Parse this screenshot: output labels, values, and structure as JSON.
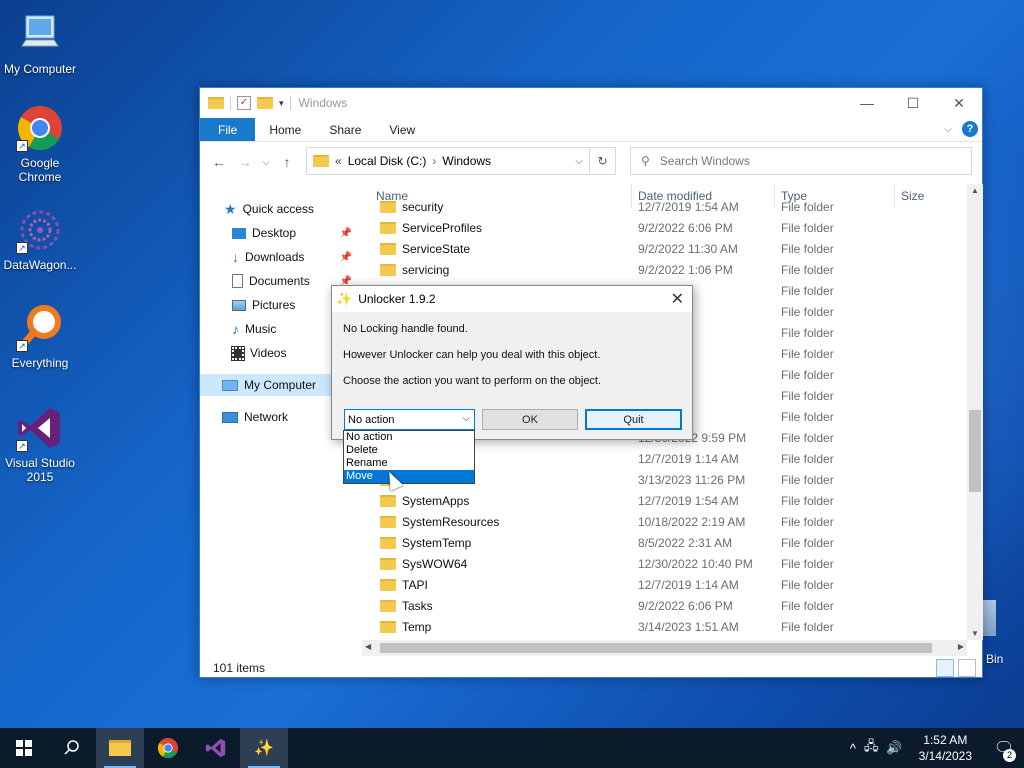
{
  "desktop": {
    "icons": [
      {
        "label": "My Computer"
      },
      {
        "label": "Google Chrome"
      },
      {
        "label": "DataWagon..."
      },
      {
        "label": "Everything"
      },
      {
        "label": "Visual Studio 2015"
      }
    ],
    "recycle_label": "Bin"
  },
  "explorer": {
    "title": "Windows",
    "tabs": {
      "file": "File",
      "home": "Home",
      "share": "Share",
      "view": "View"
    },
    "address": {
      "root": "Local Disk (C:)",
      "current": "Windows",
      "chevrons": "«"
    },
    "search_placeholder": "Search Windows",
    "sidebar": {
      "quick_access": "Quick access",
      "desktop": "Desktop",
      "downloads": "Downloads",
      "documents": "Documents",
      "pictures": "Pictures",
      "music": "Music",
      "videos": "Videos",
      "my_computer": "My Computer",
      "network": "Network"
    },
    "columns": {
      "name": "Name",
      "date": "Date modified",
      "type": "Type",
      "size": "Size"
    },
    "rows": [
      {
        "name": "security",
        "date": "12/7/2019 1:54 AM",
        "type": "File folder"
      },
      {
        "name": "ServiceProfiles",
        "date": "9/2/2022 6:06 PM",
        "type": "File folder"
      },
      {
        "name": "ServiceState",
        "date": "9/2/2022 11:30 AM",
        "type": "File folder"
      },
      {
        "name": "servicing",
        "date": "9/2/2022 1:06 PM",
        "type": "File folder"
      },
      {
        "name": "",
        "date": "1:18 AM",
        "type": "File folder"
      },
      {
        "name": "",
        "date": ":31 AM",
        "type": "File folder"
      },
      {
        "name": "",
        "date": ":31 AM",
        "type": "File folder"
      },
      {
        "name": "",
        "date": "1:31 AM",
        "type": "File folder"
      },
      {
        "name": "",
        "date": "1:17 AM",
        "type": "File folder"
      },
      {
        "name": "",
        "date": "1:14 AM",
        "type": "File folder"
      },
      {
        "name": "",
        "date": "1:14 AM",
        "type": "File folder"
      },
      {
        "name": "",
        "date": "12/30/2022 9:59 PM",
        "type": "File folder"
      },
      {
        "name": "",
        "date": "12/7/2019 1:14 AM",
        "type": "File folder"
      },
      {
        "name": "",
        "date": "3/13/2023 11:26 PM",
        "type": "File folder"
      },
      {
        "name": "SystemApps",
        "date": "12/7/2019 1:54 AM",
        "type": "File folder"
      },
      {
        "name": "SystemResources",
        "date": "10/18/2022 2:19 AM",
        "type": "File folder"
      },
      {
        "name": "SystemTemp",
        "date": "8/5/2022 2:31 AM",
        "type": "File folder"
      },
      {
        "name": "SysWOW64",
        "date": "12/30/2022 10:40 PM",
        "type": "File folder"
      },
      {
        "name": "TAPI",
        "date": "12/7/2019 1:14 AM",
        "type": "File folder"
      },
      {
        "name": "Tasks",
        "date": "9/2/2022 6:06 PM",
        "type": "File folder"
      },
      {
        "name": "Temp",
        "date": "3/14/2023 1:51 AM",
        "type": "File folder"
      }
    ],
    "status": "101 items"
  },
  "dialog": {
    "title": "Unlocker 1.9.2",
    "line1": "No Locking handle found.",
    "line2": "However Unlocker can help you deal with this object.",
    "line3": "Choose the action you want to perform on the object.",
    "combo_value": "No action",
    "ok": "OK",
    "quit": "Quit",
    "options": [
      "No action",
      "Delete",
      "Rename",
      "Move"
    ]
  },
  "taskbar": {
    "time": "1:52 AM",
    "date": "3/14/2023",
    "notification_count": "2"
  }
}
